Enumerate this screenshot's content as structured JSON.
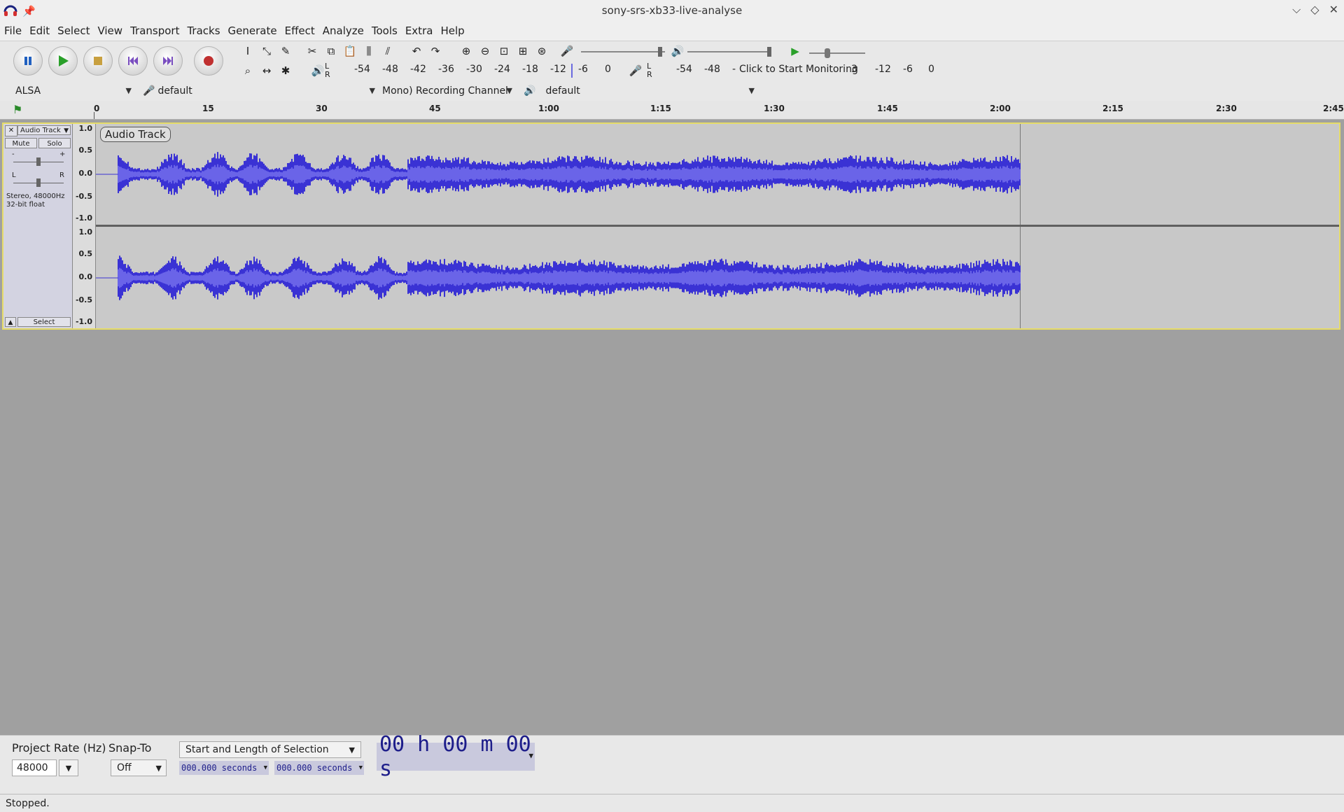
{
  "window": {
    "title": "sony-srs-xb33-live-analyse"
  },
  "menu": [
    "File",
    "Edit",
    "Select",
    "View",
    "Transport",
    "Tracks",
    "Generate",
    "Effect",
    "Analyze",
    "Tools",
    "Extra",
    "Help"
  ],
  "meters": {
    "record_ticks": [
      "-54",
      "-48",
      "-42",
      "-36",
      "-30",
      "-24",
      "-18",
      "-12",
      "-6",
      "0"
    ],
    "playback_ticks": [
      "-54",
      "-48",
      "-",
      "-12",
      "-6",
      "0"
    ],
    "monitor_prompt": "Click to Start Monitoring",
    "monitor_tick": "3",
    "lr_left": "L",
    "lr_right": "R"
  },
  "devices": {
    "host": "ALSA",
    "recording_device": "default",
    "channels": "Mono) Recording Channel",
    "playback_device": "default"
  },
  "ruler": {
    "labels": [
      "0",
      "15",
      "30",
      "45",
      "1:00",
      "1:15",
      "1:30",
      "1:45",
      "2:00",
      "2:15",
      "2:30",
      "2:45"
    ]
  },
  "track": {
    "name": "Audio Track",
    "mute": "Mute",
    "solo": "Solo",
    "gain_minus": "-",
    "gain_plus": "+",
    "pan_left": "L",
    "pan_right": "R",
    "info_line1": "Stereo, 48000Hz",
    "info_line2": "32-bit float",
    "select_label": "Select",
    "clip_name": "Audio Track",
    "scale": [
      "1.0",
      "0.5",
      "0.0",
      "-0.5",
      "-1.0"
    ],
    "waveform_color": "#3a32d4",
    "rms_color": "#6a64e8"
  },
  "bottom": {
    "project_rate_label": "Project Rate (Hz)",
    "project_rate_value": "48000",
    "snap_to_label": "Snap-To",
    "snap_to_value": "Off",
    "selection_mode": "Start and Length of Selection",
    "start_time": "000.000 seconds",
    "length_time": "000.000 seconds",
    "audio_position": "00 h 00 m 00 s"
  },
  "status": {
    "text": "Stopped."
  }
}
